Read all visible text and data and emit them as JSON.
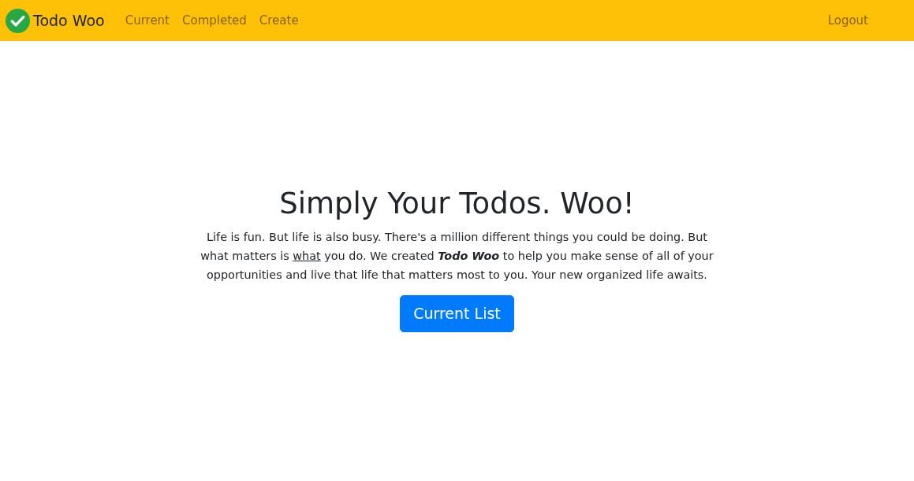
{
  "navbar": {
    "brand": "Todo Woo",
    "links": [
      {
        "label": "Current",
        "selected": false
      },
      {
        "label": "Completed",
        "selected": false
      },
      {
        "label": "Create",
        "selected": false
      }
    ],
    "right_links": [
      {
        "label": "Logout"
      }
    ]
  },
  "hero": {
    "title": "Simply Your Todos. Woo!",
    "paragraph": [
      {
        "kind": "plain",
        "text": "Life is fun. But life is also busy. There's a million different things you could be doing. But what matters is "
      },
      {
        "kind": "underlined",
        "text": "what"
      },
      {
        "kind": "plain",
        "text": " you do. We created "
      },
      {
        "kind": "emphasis",
        "text": "Todo Woo"
      },
      {
        "kind": "plain",
        "text": " to help you make sense of all of your opportunities and live that life that matters most to you. Your new organized life awaits."
      }
    ],
    "button": "Current List"
  }
}
